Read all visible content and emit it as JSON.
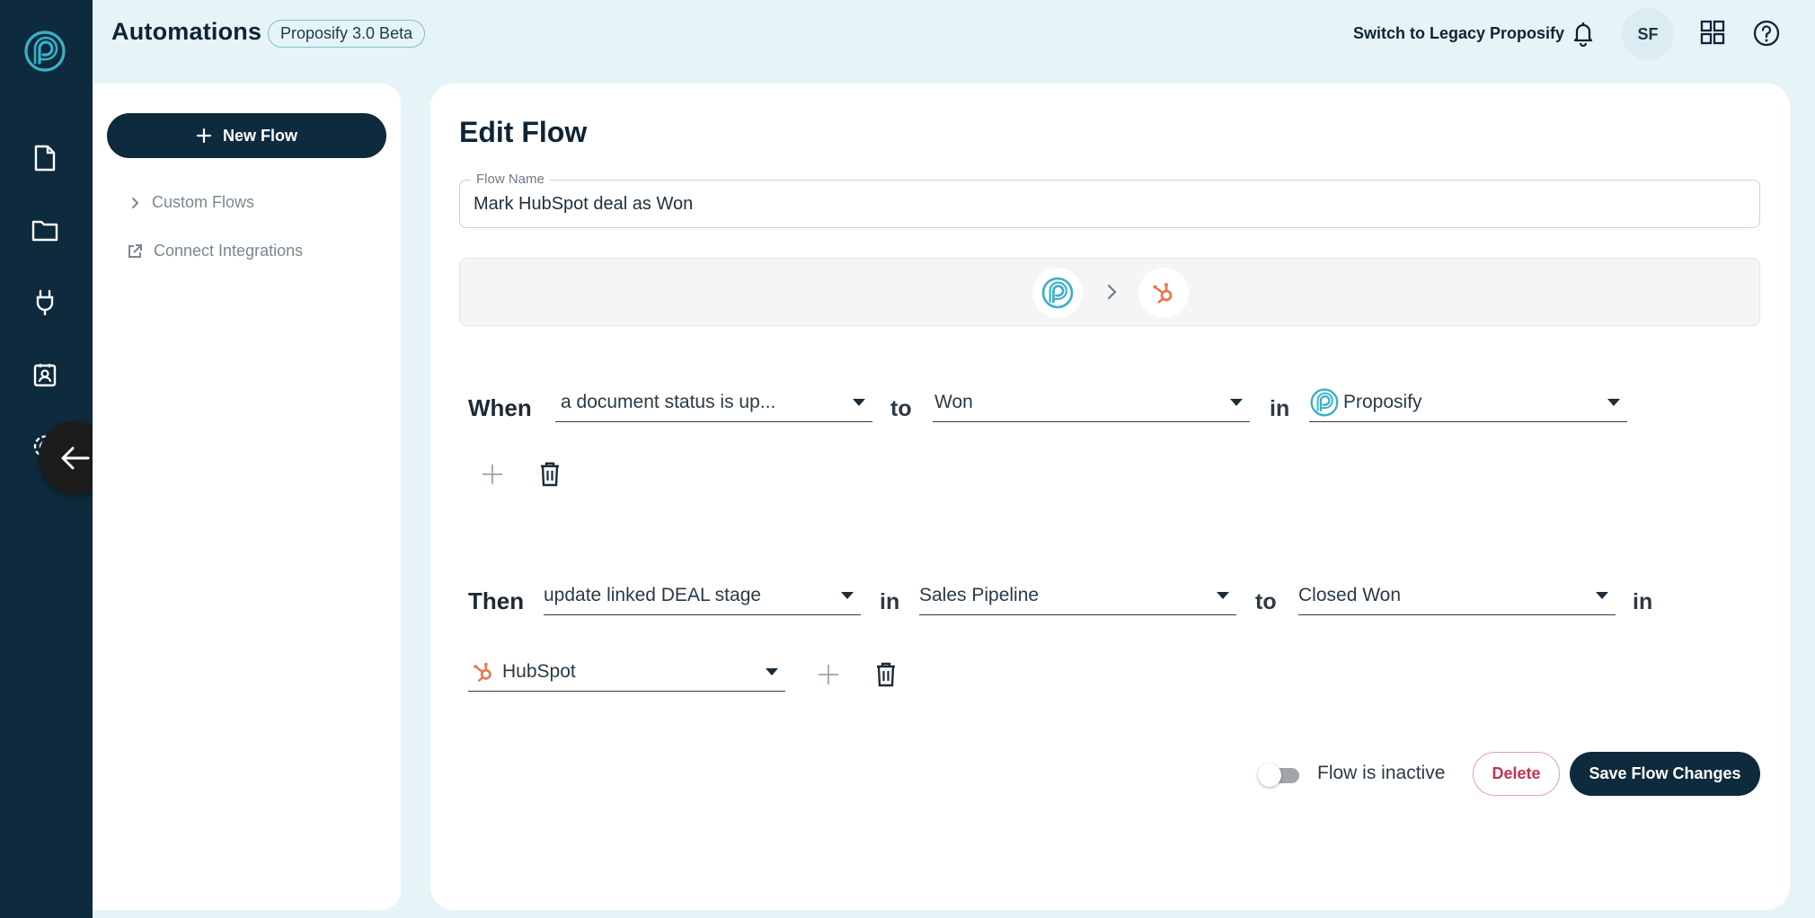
{
  "header": {
    "title": "Automations",
    "badge": "Proposify 3.0 Beta",
    "legacy_link": "Switch to Legacy Proposify",
    "avatar_initials": "SF"
  },
  "rail": {
    "items": [
      {
        "icon": "document-icon"
      },
      {
        "icon": "folder-icon"
      },
      {
        "icon": "plug-icon"
      },
      {
        "icon": "contact-card-icon"
      },
      {
        "icon": "gear-icon"
      }
    ]
  },
  "side_panel": {
    "new_flow_label": "New Flow",
    "items": [
      {
        "label": "Custom Flows",
        "icon": "chevron-right-icon"
      },
      {
        "label": "Connect Integrations",
        "icon": "external-link-icon"
      }
    ]
  },
  "main": {
    "title": "Edit Flow",
    "flow_name_label": "Flow Name",
    "flow_name_value": "Mark HubSpot deal as Won",
    "when": {
      "keyword": "When",
      "trigger": "a document status is up...",
      "to": "to",
      "status": "Won",
      "in": "in",
      "source": "Proposify"
    },
    "then": {
      "keyword": "Then",
      "action": "update linked DEAL stage",
      "in1": "in",
      "pipeline": "Sales Pipeline",
      "to": "to",
      "stage": "Closed Won",
      "in2": "in",
      "target": "HubSpot"
    },
    "status_text": "Flow is inactive",
    "active": false,
    "delete_label": "Delete",
    "save_label": "Save Flow Changes"
  },
  "colors": {
    "navy": "#0e2a3d",
    "teal": "#3aa0b8",
    "hubspot": "#e8774f",
    "danger": "#c2334d"
  }
}
